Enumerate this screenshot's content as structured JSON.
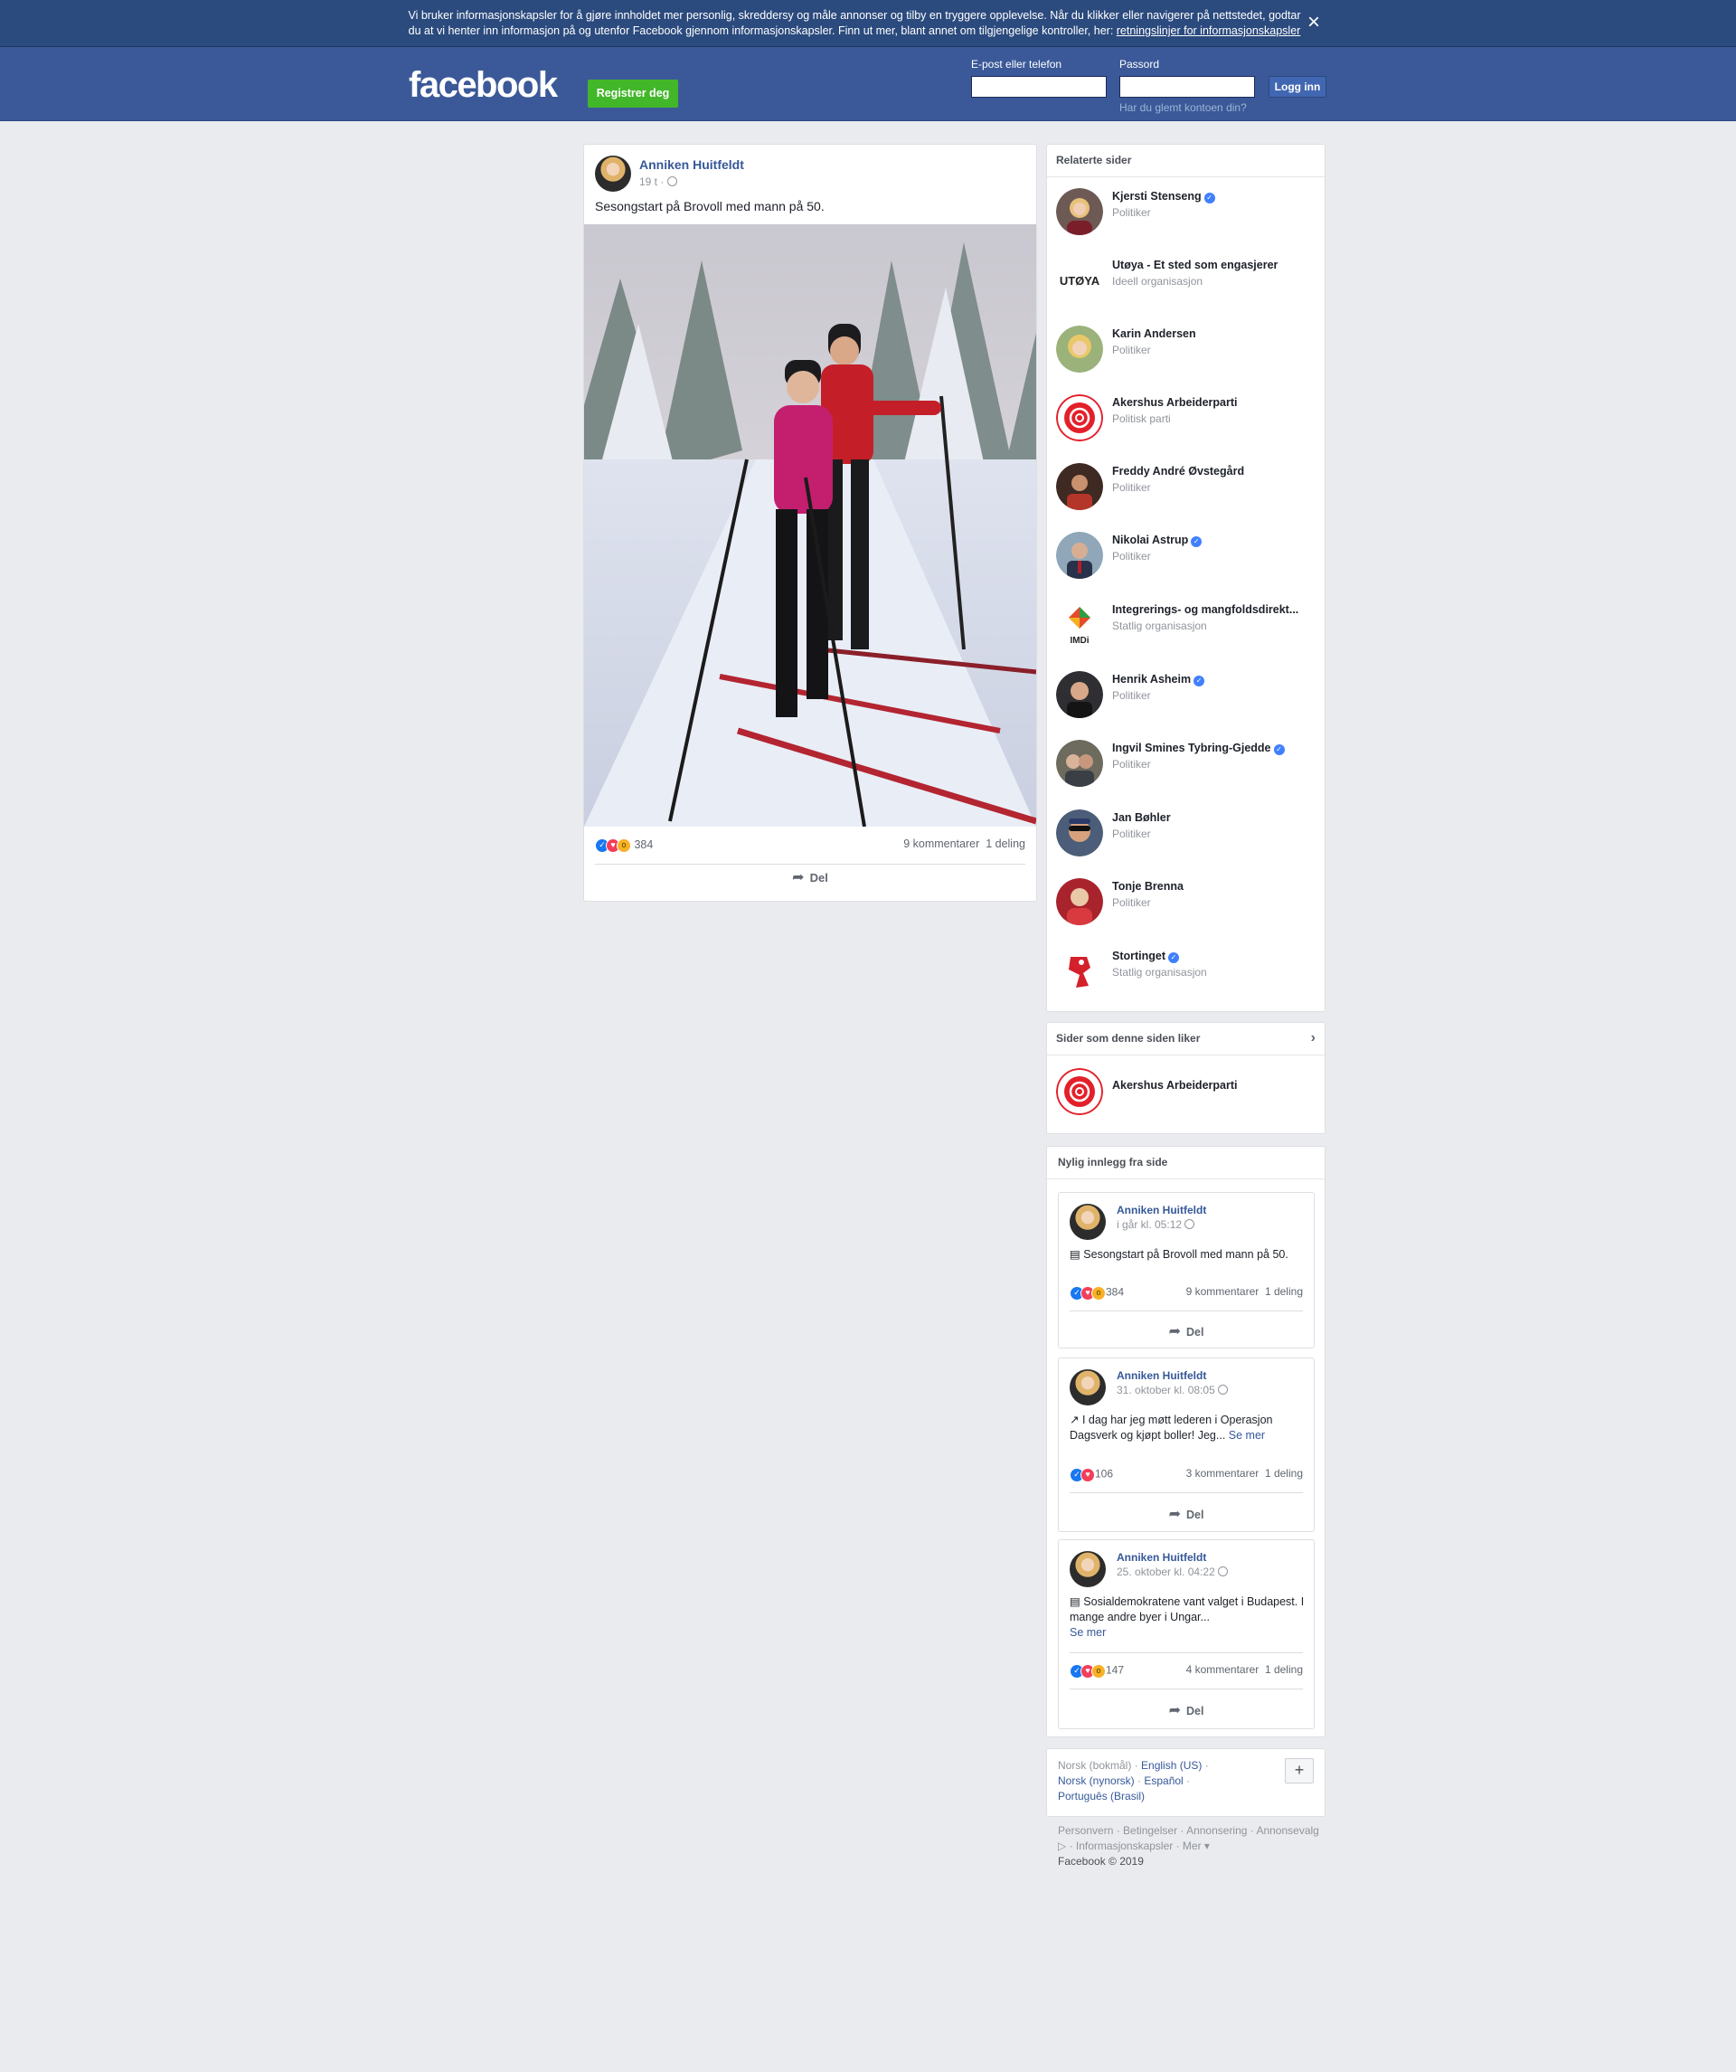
{
  "cookie_banner": {
    "text": "Vi bruker informasjonskapsler for å gjøre innholdet mer personlig, skreddersy og måle annonser og tilby en tryggere opplevelse. Når du klikker eller navigerer på nettstedet, godtar du at vi henter inn informasjon på og utenfor Facebook gjennom informasjonskapsler. Finn ut mer, blant annet om tilgjengelige kontroller, her: ",
    "link": "retningslinjer for informasjonskapsler"
  },
  "header": {
    "logo": "facebook",
    "register": "Registrer deg",
    "email_label": "E-post eller telefon",
    "password_label": "Passord",
    "login": "Logg inn",
    "forgot": "Har du glemt kontoen din?"
  },
  "post": {
    "author": "Anniken Huitfeldt",
    "time": "19 t ·",
    "text": "Sesongstart på Brovoll med mann på 50.",
    "reactions": "384",
    "comments": "9 kommentarer",
    "shares": "1 deling",
    "share": "Del"
  },
  "related": {
    "title": "Relaterte sider",
    "items": [
      {
        "name": "Kjersti Stenseng",
        "category": "Politiker",
        "verified": true
      },
      {
        "name": "Utøya - Et sted som engasjerer",
        "category": "Ideell organisasjon",
        "verified": false
      },
      {
        "name": "Karin Andersen",
        "category": "Politiker",
        "verified": false
      },
      {
        "name": "Akershus Arbeiderparti",
        "category": "Politisk parti",
        "verified": false
      },
      {
        "name": "Freddy André Øvstegård",
        "category": "Politiker",
        "verified": false
      },
      {
        "name": "Nikolai Astrup",
        "category": "Politiker",
        "verified": true
      },
      {
        "name": "Integrerings- og mangfoldsdirekt...",
        "category": "Statlig organisasjon",
        "verified": false
      },
      {
        "name": "Henrik Asheim",
        "category": "Politiker",
        "verified": true
      },
      {
        "name": "Ingvil Smines Tybring-Gjedde",
        "category": "Politiker",
        "verified": true
      },
      {
        "name": "Jan Bøhler",
        "category": "Politiker",
        "verified": false
      },
      {
        "name": "Tonje Brenna",
        "category": "Politiker",
        "verified": false
      },
      {
        "name": "Stortinget",
        "category": "Statlig organisasjon",
        "verified": true
      }
    ],
    "logo_text_utoya": "UTØYA",
    "logo_text_imdi": "IMDi"
  },
  "liked": {
    "title": "Sider som denne siden liker",
    "item": "Akershus Arbeiderparti"
  },
  "recent": {
    "title": "Nylig innlegg fra side",
    "posts": [
      {
        "author": "Anniken Huitfeldt",
        "time": "i går kl. 05:12",
        "text": "Sesongstart på Brovoll med mann på 50.",
        "see_more": "",
        "reactions": "384",
        "comments": "9 kommentarer",
        "shares": "1 deling",
        "share": "Del"
      },
      {
        "author": "Anniken Huitfeldt",
        "time": "31. oktober kl. 08:05",
        "text": "I dag har jeg møtt lederen i Operasjon Dagsverk og kjøpt boller! Jeg...",
        "see_more": "Se mer",
        "reactions": "106",
        "comments": "3 kommentarer",
        "shares": "1 deling",
        "share": "Del"
      },
      {
        "author": "Anniken Huitfeldt",
        "time": "25. oktober kl. 04:22",
        "text": "Sosialdemokratene vant valget i Budapest. I mange andre byer i Ungar...",
        "see_more": "Se mer",
        "reactions": "147",
        "comments": "4 kommentarer",
        "shares": "1 deling",
        "share": "Del"
      }
    ]
  },
  "languages": {
    "current": "Norsk (bokmål) · ",
    "l1": "English (US)",
    "l2": "Norsk (nynorsk)",
    "l3": "Español",
    "l4": "Português (Brasil)",
    "plus": "+"
  },
  "footer": {
    "links": "Personvern · Betingelser · Annonsering · Annonsevalg ▷ · Informasjonskapsler · Mer ▾",
    "copyright": "Facebook © 2019"
  },
  "colors": {
    "header": "#3b5998",
    "register": "#42b72a",
    "link": "#365899"
  }
}
